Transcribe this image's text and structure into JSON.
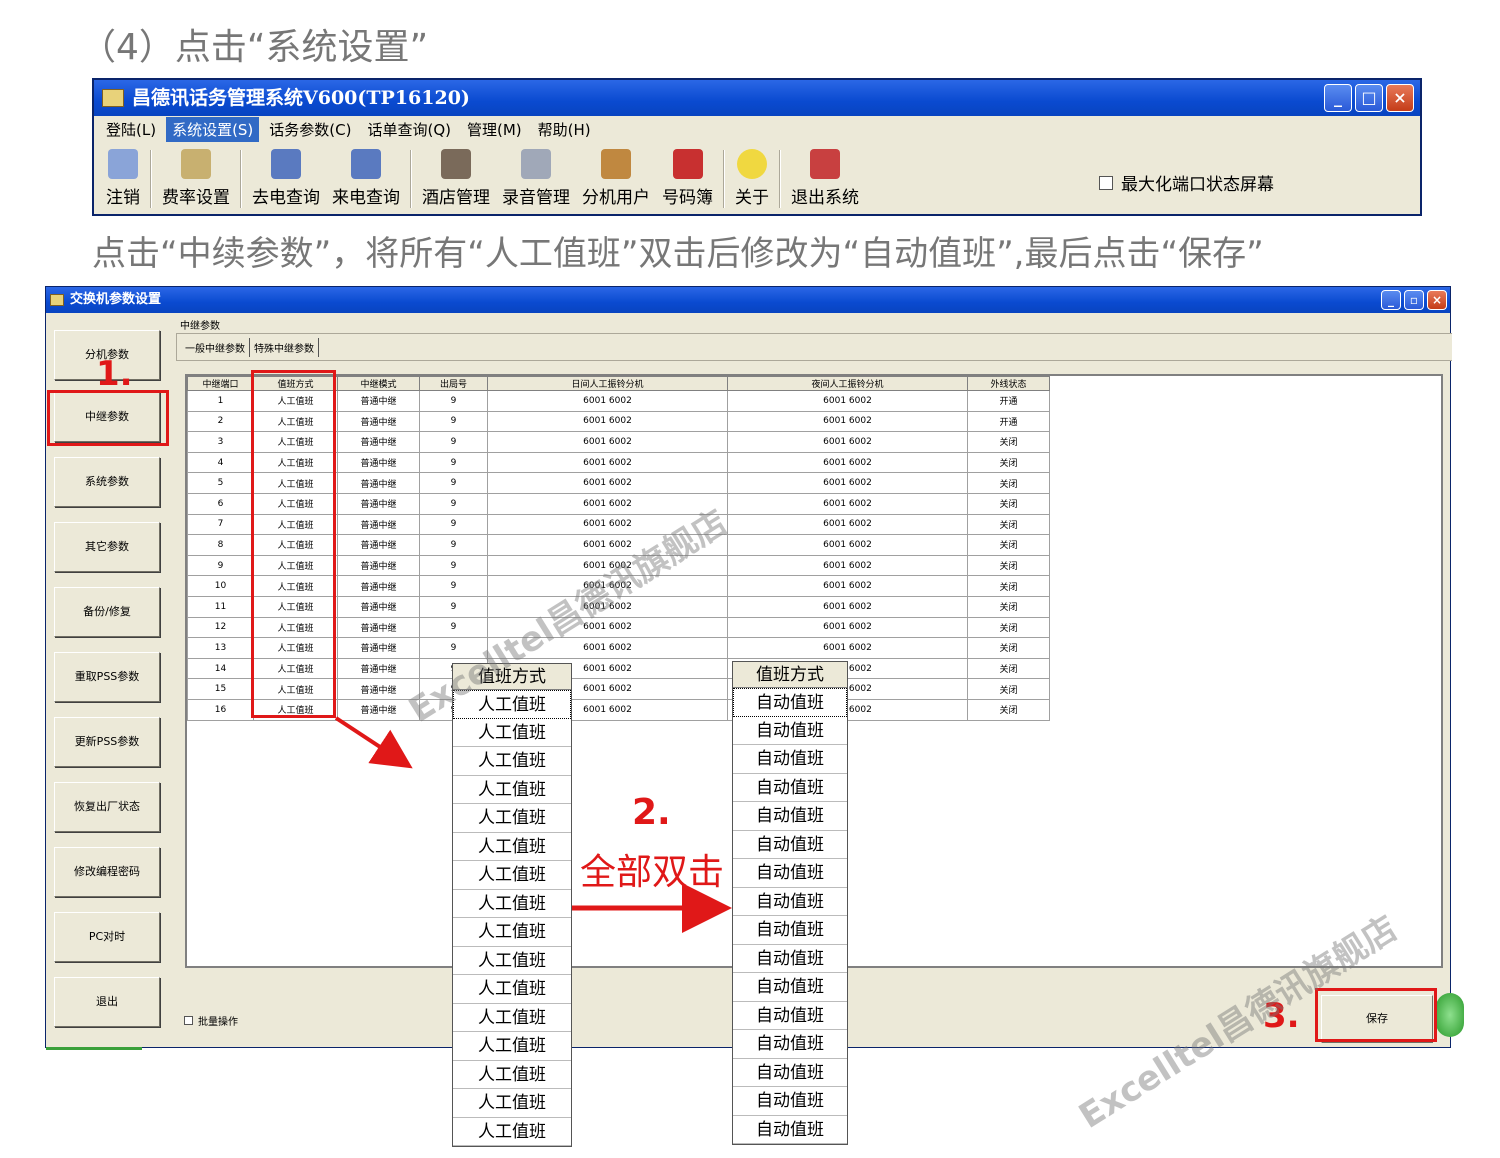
{
  "captions": {
    "step4": "（4）点击“系统设置”",
    "instruction": "点击“中续参数”，将所有“人工值班”双击后修改为“自动值班”,最后点击“保存”"
  },
  "main_window": {
    "title": "昌德讯话务管理系统V600(TP16120)",
    "menu": [
      "登陆(L)",
      "系统设置(S)",
      "话务参数(C)",
      "话单查询(Q)",
      "管理(M)",
      "帮助(H)"
    ],
    "toolbar": [
      "注销",
      "费率设置",
      "去电查询",
      "来电查询",
      "酒店管理",
      "录音管理",
      "分机用户",
      "号码簿",
      "关于",
      "退出系统"
    ],
    "maximize_checkbox": "最大化端口状态屏幕"
  },
  "settings_window": {
    "title": "交换机参数设置",
    "side_buttons": [
      "分机参数",
      "中继参数",
      "系统参数",
      "其它参数",
      "备份/修复",
      "重取PSS参数",
      "更新PSS参数",
      "恢复出厂状态",
      "修改编程密码",
      "PC对时",
      "退出"
    ],
    "group_label": "中继参数",
    "tabs": [
      "一般中继参数",
      "特殊中继参数"
    ],
    "columns": [
      "中继端口",
      "值班方式",
      "中继模式",
      "出局号",
      "日间人工振铃分机",
      "夜间人工振铃分机",
      "外线状态"
    ],
    "rows": [
      [
        "1",
        "人工值班",
        "普通中继",
        "9",
        "6001 6002",
        "6001 6002",
        "开通"
      ],
      [
        "2",
        "人工值班",
        "普通中继",
        "9",
        "6001 6002",
        "6001 6002",
        "开通"
      ],
      [
        "3",
        "人工值班",
        "普通中继",
        "9",
        "6001 6002",
        "6001 6002",
        "关闭"
      ],
      [
        "4",
        "人工值班",
        "普通中继",
        "9",
        "6001 6002",
        "6001 6002",
        "关闭"
      ],
      [
        "5",
        "人工值班",
        "普通中继",
        "9",
        "6001 6002",
        "6001 6002",
        "关闭"
      ],
      [
        "6",
        "人工值班",
        "普通中继",
        "9",
        "6001 6002",
        "6001 6002",
        "关闭"
      ],
      [
        "7",
        "人工值班",
        "普通中继",
        "9",
        "6001 6002",
        "6001 6002",
        "关闭"
      ],
      [
        "8",
        "人工值班",
        "普通中继",
        "9",
        "6001 6002",
        "6001 6002",
        "关闭"
      ],
      [
        "9",
        "人工值班",
        "普通中继",
        "9",
        "6001 6002",
        "6001 6002",
        "关闭"
      ],
      [
        "10",
        "人工值班",
        "普通中继",
        "9",
        "6001 6002",
        "6001 6002",
        "关闭"
      ],
      [
        "11",
        "人工值班",
        "普通中继",
        "9",
        "6001 6002",
        "6001 6002",
        "关闭"
      ],
      [
        "12",
        "人工值班",
        "普通中继",
        "9",
        "6001 6002",
        "6001 6002",
        "关闭"
      ],
      [
        "13",
        "人工值班",
        "普通中继",
        "9",
        "6001 6002",
        "6001 6002",
        "关闭"
      ],
      [
        "14",
        "人工值班",
        "普通中继",
        "9",
        "6001 6002",
        "6001 6002",
        "关闭"
      ],
      [
        "15",
        "人工值班",
        "普通中继",
        "9",
        "6001 6002",
        "6001 6002",
        "关闭"
      ],
      [
        "16",
        "人工值班",
        "普通中继",
        "9",
        "6001 6002",
        "6001 6002",
        "关闭"
      ]
    ],
    "batch_checkbox": "批量操作",
    "save_button": "保存"
  },
  "popup_before": {
    "header": "值班方式",
    "value": "人工值班",
    "count": 16
  },
  "popup_after": {
    "header": "值班方式",
    "value": "自动值班",
    "count": 16
  },
  "annotations": {
    "step1": "1.",
    "step2": "2.",
    "step2_text": "全部双击",
    "step3": "3."
  },
  "watermark": "Excelltel昌德讯旗舰店",
  "colors": {
    "annotation_red": "#e01818",
    "titlebar_blue": "#0a4ad0"
  }
}
